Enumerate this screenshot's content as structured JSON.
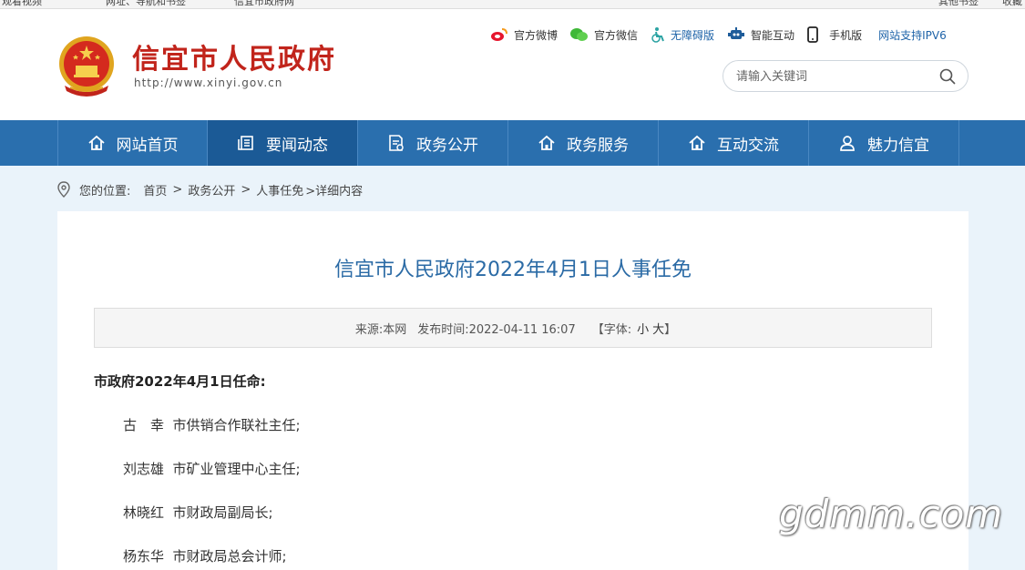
{
  "browser": {
    "bookmarks": [
      "观看视频",
      "网址、导航和书签",
      "信宜市政府网",
      "其他书签",
      "收藏"
    ]
  },
  "header": {
    "site_name": "信宜市人民政府",
    "site_url": "http://www.xinyi.gov.cn",
    "links": {
      "weibo": "官方微博",
      "wechat": "官方微信",
      "accessible": "无障碍版",
      "interactive": "智能互动",
      "mobile": "手机版",
      "ipv6": "网站支持IPV6"
    },
    "search": {
      "placeholder": "请输入关键词"
    }
  },
  "nav": {
    "items": [
      {
        "label": "网站首页",
        "icon": "home-icon"
      },
      {
        "label": "要闻动态",
        "icon": "news-icon"
      },
      {
        "label": "政务公开",
        "icon": "document-icon"
      },
      {
        "label": "政务服务",
        "icon": "home-icon"
      },
      {
        "label": "互动交流",
        "icon": "home-icon"
      },
      {
        "label": "魅力信宜",
        "icon": "user-icon"
      }
    ]
  },
  "breadcrumb": {
    "prefix": "您的位置:",
    "home": "首页",
    "sep1": ">",
    "section": "政务公开",
    "sep2": ">",
    "sub": "人事任免",
    "current": ">详细内容"
  },
  "article": {
    "title": "信宜市人民政府2022年4月1日人事任免",
    "meta": {
      "source": "来源:本网",
      "published": "发布时间:2022-04-11 16:07",
      "font_label": "【字体:",
      "font_small": "小",
      "font_large": "大",
      "font_end": "】"
    },
    "lead": "市政府2022年4月1日任命:",
    "appointments": [
      "古　幸  市供销合作联社主任;",
      "刘志雄  市矿业管理中心主任;",
      "林晓红  市财政局副局长;",
      "杨东华  市财政局总会计师;"
    ]
  },
  "watermark": "gdmm.com",
  "colors": {
    "brand_red": "#c1241b",
    "nav_blue": "#2a6fae",
    "title_blue": "#2a6aa5"
  }
}
